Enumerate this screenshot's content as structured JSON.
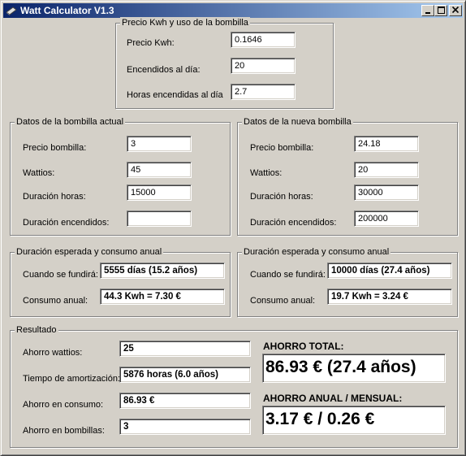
{
  "window": {
    "title": "Watt Calculator V1.3",
    "controls": {
      "minimize": "_",
      "maximize": "□",
      "close": "✕"
    }
  },
  "kwh_group": {
    "legend": "Precio Kwh y uso de la bombilla",
    "precio_kwh": {
      "label": "Precio Kwh:",
      "value": "0.1646"
    },
    "encendidos": {
      "label": "Encendidos al día:",
      "value": "20"
    },
    "horas": {
      "label": "Horas encendidas al día",
      "value": "2.7"
    }
  },
  "actual": {
    "legend": "Datos de la bombilla actual",
    "precio": {
      "label": "Precio bombilla:",
      "value": "3"
    },
    "wattios": {
      "label": "Wattios:",
      "value": "45"
    },
    "duracion_horas": {
      "label": "Duración horas:",
      "value": "15000"
    },
    "duracion_encendidos": {
      "label": "Duración encendidos:",
      "value": ""
    }
  },
  "nueva": {
    "legend": "Datos de la nueva bombilla",
    "precio": {
      "label": "Precio bombilla:",
      "value": "24.18"
    },
    "wattios": {
      "label": "Wattios:",
      "value": "20"
    },
    "duracion_horas": {
      "label": "Duración horas:",
      "value": "30000"
    },
    "duracion_encendidos": {
      "label": "Duración encendidos:",
      "value": "200000"
    }
  },
  "actual_consumo": {
    "legend": "Duración esperada y consumo anual",
    "fundira": {
      "label": "Cuando se fundirá:",
      "value": "5555 días (15.2 años)"
    },
    "consumo": {
      "label": "Consumo anual:",
      "value": "44.3 Kwh  = 7.30 €"
    }
  },
  "nueva_consumo": {
    "legend": "Duración esperada y consumo anual",
    "fundira": {
      "label": "Cuando se fundirá:",
      "value": "10000 días (27.4 años)"
    },
    "consumo": {
      "label": "Consumo anual:",
      "value": "19.7 Kwh  = 3.24 €"
    }
  },
  "resultado": {
    "legend": "Resultado",
    "ahorro_wattios": {
      "label": "Ahorro wattios:",
      "value": "25"
    },
    "amortizacion": {
      "label": "Tiempo de amortización:",
      "value": "5876 horas (6.0 años)"
    },
    "ahorro_consumo": {
      "label": "Ahorro en consumo:",
      "value": "86.93 €"
    },
    "ahorro_bombillas": {
      "label": "Ahorro en bombillas:",
      "value": "3"
    },
    "ahorro_total": {
      "label": "AHORRO TOTAL:",
      "value": "86.93 € (27.4 años)"
    },
    "ahorro_anual": {
      "label": "AHORRO ANUAL / MENSUAL:",
      "value": "3.17 € / 0.26 €"
    }
  }
}
